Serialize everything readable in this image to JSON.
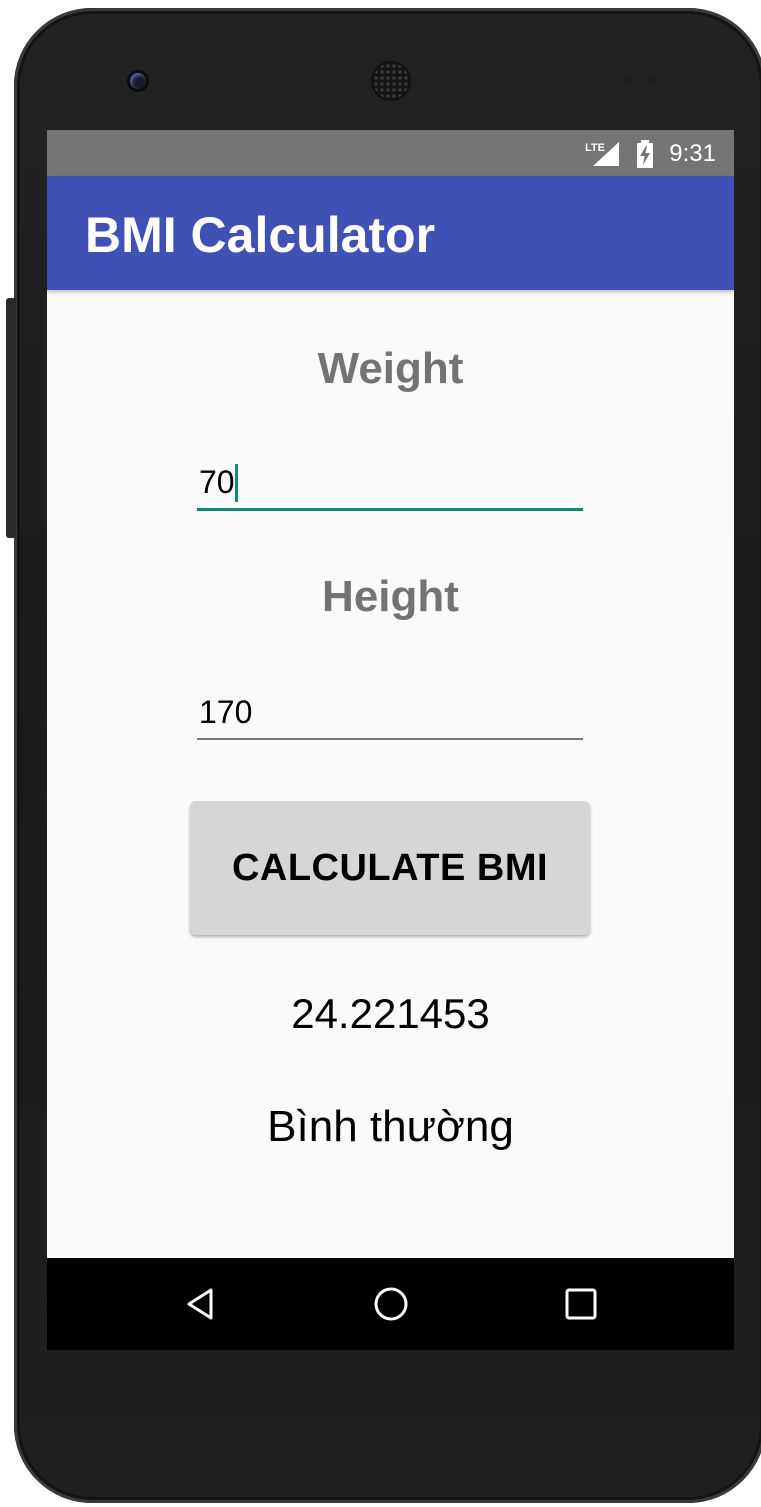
{
  "status_bar": {
    "network_label": "LTE",
    "time": "9:31",
    "icons": [
      "signal-icon",
      "battery-charging-icon"
    ]
  },
  "app_bar": {
    "title": "BMI Calculator"
  },
  "form": {
    "weight_label": "Weight",
    "weight_value": "70",
    "height_label": "Height",
    "height_value": "170",
    "calculate_label": "CALCULATE BMI"
  },
  "result": {
    "bmi_value": "24.221453",
    "status": "Bình thường"
  },
  "nav_bar": {
    "icons": [
      "back-icon",
      "home-icon",
      "recent-apps-icon"
    ]
  },
  "colors": {
    "primary": "#3f51b5",
    "status_bar": "#757575",
    "accent": "#158873",
    "button": "#d6d6d6"
  }
}
